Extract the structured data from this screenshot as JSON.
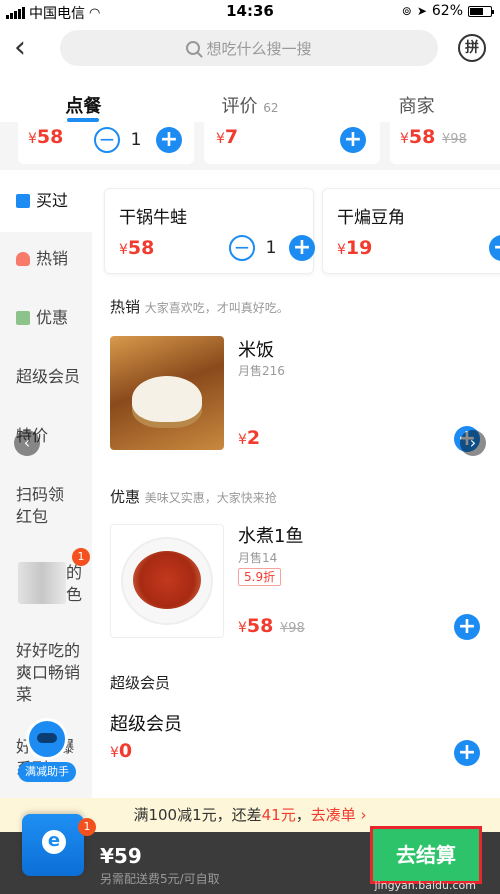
{
  "status_bar": {
    "carrier": "中国电信",
    "time": "14:36",
    "battery": "62%"
  },
  "header": {
    "search_placeholder": "想吃什么搜一搜",
    "group_icon_text": "拼"
  },
  "tabs": [
    {
      "label": "点餐",
      "active": true
    },
    {
      "label": "评价",
      "count": "62"
    },
    {
      "label": "商家"
    }
  ],
  "top_strip": [
    {
      "price": "58",
      "qty": "1"
    },
    {
      "price": "7"
    },
    {
      "price": "58",
      "original": "¥98"
    }
  ],
  "currency": "¥",
  "sidebar": {
    "items": [
      {
        "label": "买过",
        "icon": "bag-icon"
      },
      {
        "label": "热销",
        "icon": "fire-icon"
      },
      {
        "label": "优惠",
        "icon": "coupon-icon"
      },
      {
        "label": "超级会员"
      },
      {
        "label": "特价"
      },
      {
        "label": "扫码领红包"
      },
      {
        "label_top": "的",
        "label_bottom": "色",
        "badge": "1"
      },
      {
        "label": "好好吃的爽口畅销菜"
      },
      {
        "label": "好 爆 爆 系列"
      }
    ]
  },
  "recommended": [
    {
      "name": "干锅牛蛙",
      "price": "58",
      "qty": "1"
    },
    {
      "name": "干煸豆角",
      "price": "19"
    }
  ],
  "sections": {
    "hot": {
      "title": "热销",
      "subtitle": "大家喜欢吃，才叫真好吃。"
    },
    "discount": {
      "title": "优惠",
      "subtitle": "美味又实惠，大家快来抢"
    },
    "vip": {
      "title": "超级会员"
    }
  },
  "items": {
    "rice": {
      "name": "米饭",
      "sold": "月售216",
      "price": "2"
    },
    "fish": {
      "name": "水煮1鱼",
      "sold": "月售14",
      "discount": "5.9折",
      "price": "58",
      "original": "¥98"
    },
    "vip_item": {
      "name": "超级会员",
      "price": "0"
    }
  },
  "promo": {
    "prefix": "满100减1元，还差",
    "amount": "41元",
    "suffix": "，",
    "link": "去凑单 ›"
  },
  "cart": {
    "badge": "1",
    "total": "¥59",
    "note": "另需配送费5元/可自取",
    "checkout": "去结算",
    "watermark": "jingyan.baidu.com"
  },
  "helper": {
    "label": "满减助手"
  },
  "colors": {
    "accent": "#1c8cf3",
    "price": "#f23b2f",
    "checkout": "#2cc36b"
  }
}
